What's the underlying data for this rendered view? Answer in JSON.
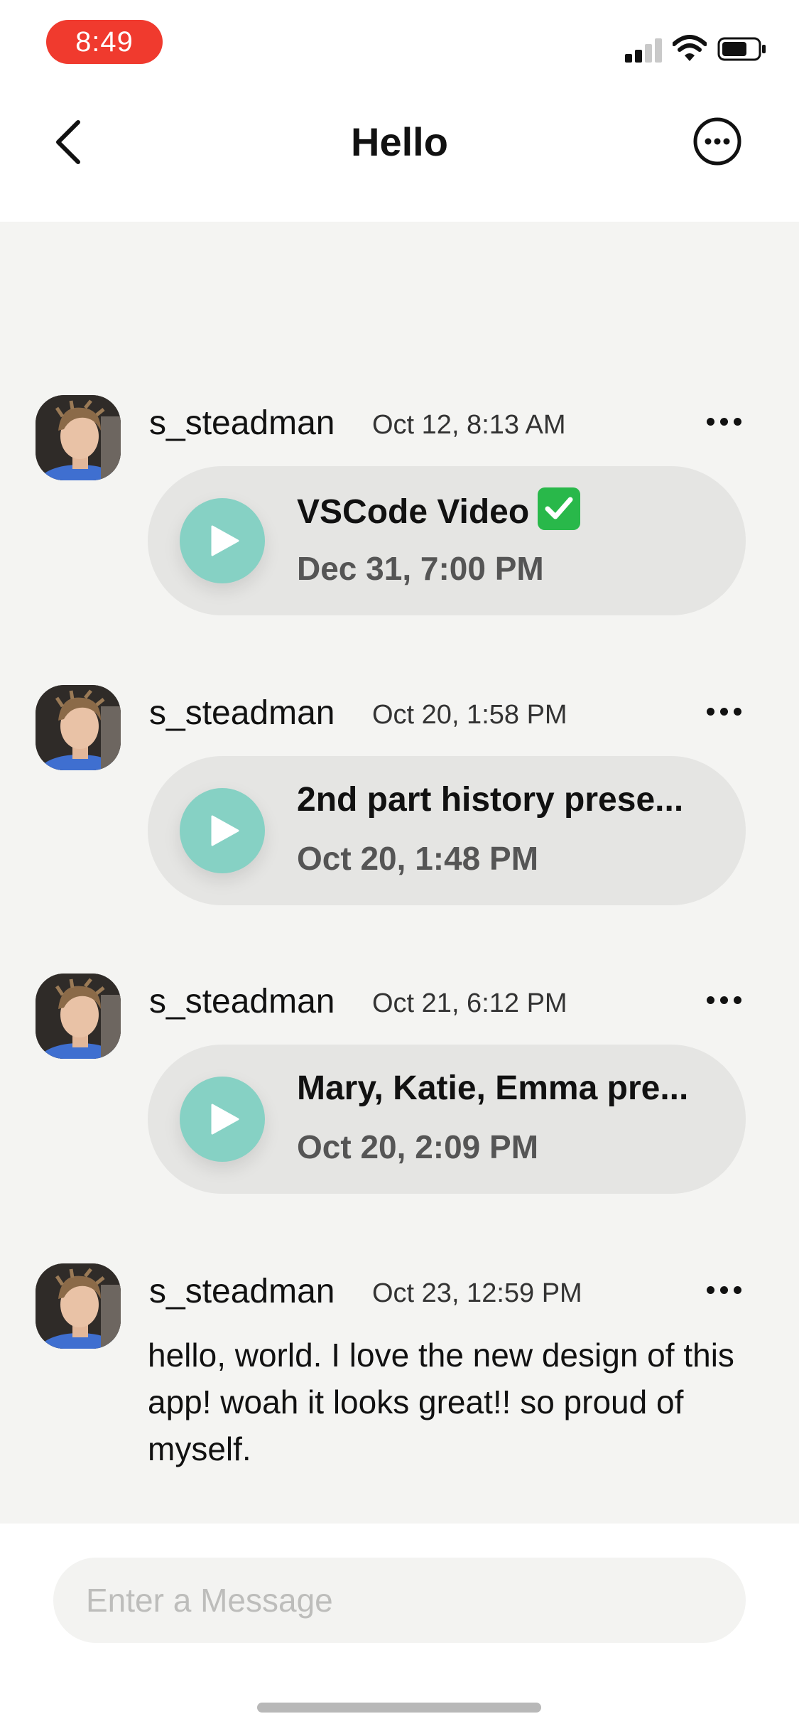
{
  "status_bar": {
    "time": "8:49",
    "time_pill_color": "#f03a2e",
    "signal_icon": "cellular-signal-icon",
    "wifi_icon": "wifi-icon",
    "battery_icon": "battery-icon"
  },
  "header": {
    "title": "Hello",
    "back_icon": "chevron-left-icon",
    "more_icon": "ellipsis-circle-icon"
  },
  "colors": {
    "accent_play": "#86d1c4",
    "card_background": "#e5e5e3",
    "chat_background": "#f4f4f2"
  },
  "messages": [
    {
      "username": "s_steadman",
      "timestamp": "Oct 12, 8:13 AM",
      "type": "video",
      "card_title": "VSCode Video",
      "card_badge": "check-mark-button-emoji",
      "card_date": "Dec 31, 7:00 PM"
    },
    {
      "username": "s_steadman",
      "timestamp": "Oct 20, 1:58 PM",
      "type": "video",
      "card_title": "2nd part history prese...",
      "card_date": "Oct 20, 1:48 PM"
    },
    {
      "username": "s_steadman",
      "timestamp": "Oct 21, 6:12 PM",
      "type": "video",
      "card_title": "Mary, Katie, Emma pre...",
      "card_date": "Oct 20, 2:09 PM"
    },
    {
      "username": "s_steadman",
      "timestamp": "Oct 23, 12:59 PM",
      "type": "text",
      "text": "hello, world. I love the new design of this app! woah it looks great!! so proud of myself."
    }
  ],
  "composer": {
    "placeholder": "Enter a Message",
    "value": ""
  }
}
